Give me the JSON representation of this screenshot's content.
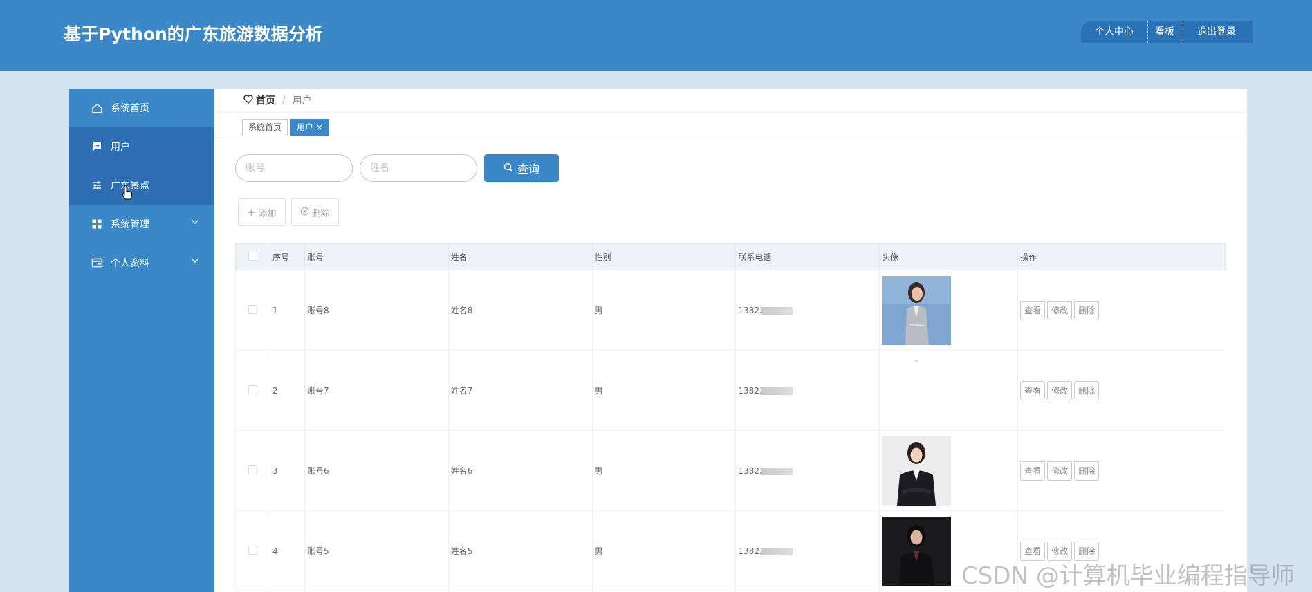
{
  "header": {
    "title": "基于Python的广东旅游数据分析",
    "nav": [
      "个人中心",
      "看板",
      "退出登录"
    ]
  },
  "sidebar": {
    "items": [
      {
        "label": "系统首页",
        "icon": "home-icon"
      },
      {
        "label": "用户",
        "icon": "chat-icon"
      },
      {
        "label": "广东景点",
        "icon": "sliders-icon"
      },
      {
        "label": "系统管理",
        "icon": "grid-icon",
        "expandable": true
      },
      {
        "label": "个人资料",
        "icon": "wallet-icon",
        "expandable": true
      }
    ]
  },
  "breadcrumb": {
    "home": "首页",
    "separator": "/",
    "current": "用户"
  },
  "tabs": [
    {
      "label": "系统首页",
      "active": false
    },
    {
      "label": "用户 ×",
      "active": true
    }
  ],
  "search": {
    "account_placeholder": "账号",
    "name_placeholder": "姓名",
    "button_label": "查询"
  },
  "actions": {
    "add_label": "添加",
    "delete_label": "删除"
  },
  "table": {
    "headers": [
      "",
      "序号",
      "账号",
      "姓名",
      "性别",
      "联系电话",
      "头像",
      "操作"
    ],
    "rows": [
      {
        "index": "1",
        "account": "账号8",
        "name": "姓名8",
        "gender": "男",
        "phone": "13823",
        "avatar": "woman-gray-suit"
      },
      {
        "index": "2",
        "account": "账号7",
        "name": "姓名7",
        "gender": "男",
        "phone": "13823",
        "avatar": "blank"
      },
      {
        "index": "3",
        "account": "账号6",
        "name": "姓名6",
        "gender": "男",
        "phone": "13823",
        "avatar": "woman-black-suit"
      },
      {
        "index": "4",
        "account": "账号5",
        "name": "姓名5",
        "gender": "男",
        "phone": "13823",
        "avatar": "woman-dark-background"
      }
    ],
    "row_actions": [
      "查看",
      "修改",
      "删除"
    ]
  },
  "watermark": "CSDN @计算机毕业编程指导师",
  "colors": {
    "primary": "#3b88c9",
    "sidebar_active": "#2e6fb4",
    "page_bg": "#d3e3f1"
  }
}
